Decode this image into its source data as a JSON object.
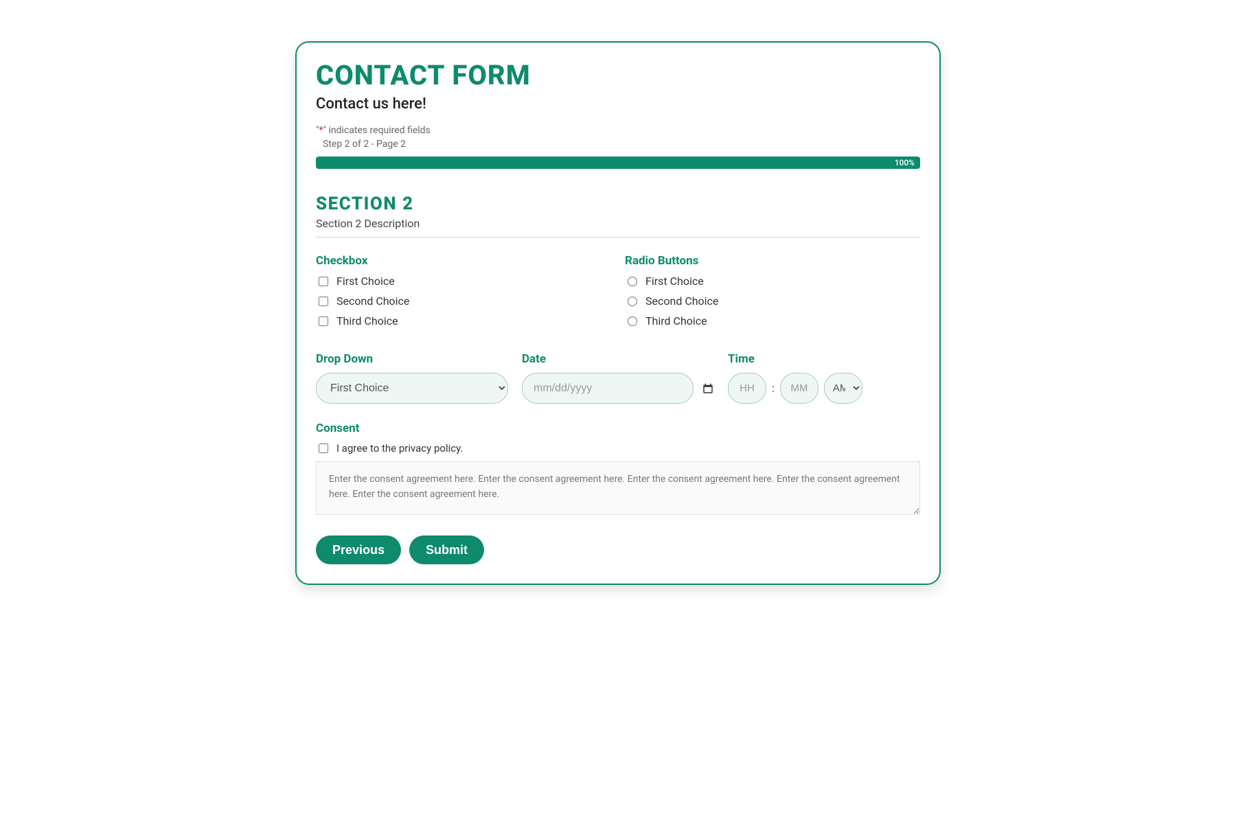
{
  "header": {
    "title": "CONTACT FORM",
    "subtitle": "Contact us here!",
    "required_note_prefix": "\"",
    "required_note_asterisk": "*",
    "required_note_suffix": "\" indicates required fields",
    "step_note": "Step 2 of 2 - Page 2",
    "progress_text": "100%"
  },
  "section": {
    "title": "SECTION 2",
    "description": "Section 2 Description"
  },
  "checkbox_field": {
    "label": "Checkbox",
    "options": [
      "First Choice",
      "Second Choice",
      "Third Choice"
    ]
  },
  "radio_field": {
    "label": "Radio Buttons",
    "options": [
      "First Choice",
      "Second Choice",
      "Third Choice"
    ]
  },
  "dropdown_field": {
    "label": "Drop Down",
    "selected": "First Choice"
  },
  "date_field": {
    "label": "Date",
    "placeholder": "mm/dd/yyyy"
  },
  "time_field": {
    "label": "Time",
    "hh_placeholder": "HH",
    "mm_placeholder": "MM",
    "ampm_selected": "AM"
  },
  "consent_field": {
    "label": "Consent",
    "agree_text": "I agree to the privacy policy.",
    "agreement_text": "Enter the consent agreement here. Enter the consent agreement here. Enter the consent agreement here. Enter the consent agreement here. Enter the consent agreement here."
  },
  "buttons": {
    "previous": "Previous",
    "submit": "Submit"
  }
}
